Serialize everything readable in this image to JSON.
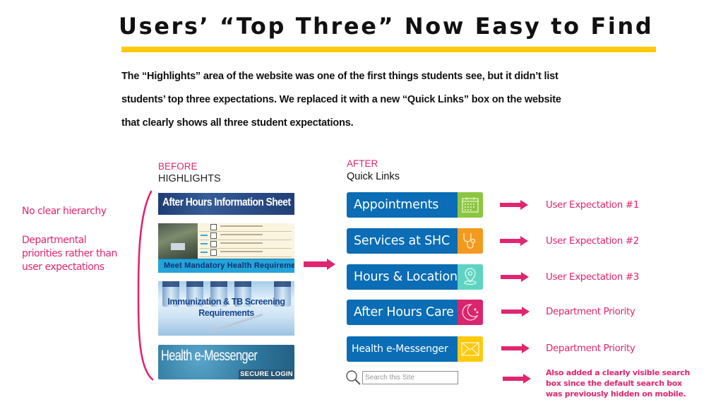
{
  "header": {
    "title": "Users’ “Top Three” Now Easy to Find",
    "accent_color": "#ffc90e"
  },
  "intro": {
    "lines": [
      "The “Highlights” area of the website was one of the first things students see, but it didn’t list",
      "students’ top three expectations. We replaced it with a new “Quick Links” box on the website",
      "that clearly shows all three student expectations."
    ]
  },
  "left_notes": {
    "note1": "No clear hierarchy",
    "note2": "Departmental priorities rather than user expectations",
    "color": "#e0266f"
  },
  "before": {
    "tag": "BEFORE",
    "heading": "HIGHLIGHTS",
    "tiles": [
      {
        "label": "After Hours Information Sheet"
      },
      {
        "label": "Meet Mandatory Health Requirements"
      },
      {
        "label_line1": "Immunization & TB Screening",
        "label_line2": "Requirements"
      },
      {
        "label": "Health e-Messenger",
        "sub_button": "SECURE LOGIN ▸"
      }
    ]
  },
  "after": {
    "tag": "AFTER",
    "heading": "Quick Links",
    "links": [
      {
        "label": "Appointments",
        "icon": "calendar-icon",
        "icon_color": "#8cc63f",
        "outcome": "User Expectation #1"
      },
      {
        "label": "Services at SHC",
        "icon": "stethoscope-icon",
        "icon_color": "#f39a1e",
        "outcome": "User Expectation #2"
      },
      {
        "label": "Hours & Location",
        "icon": "location-pin-icon",
        "icon_color": "#5fd4c2",
        "outcome": "User Expectation #3"
      },
      {
        "label": "After Hours Care",
        "icon": "moon-icon",
        "icon_color": "#d9246e",
        "outcome": "Department Priority"
      },
      {
        "label": "Health e-Messenger",
        "icon": "envelope-icon",
        "icon_color": "#ffc90e",
        "outcome": "Department Priority"
      }
    ],
    "button_color": "#0a6db5",
    "search": {
      "placeholder": "Search this Site",
      "icon": "search-icon",
      "note": "Also added a clearly visible search box since the default search box was previously hidden on mobile."
    }
  }
}
